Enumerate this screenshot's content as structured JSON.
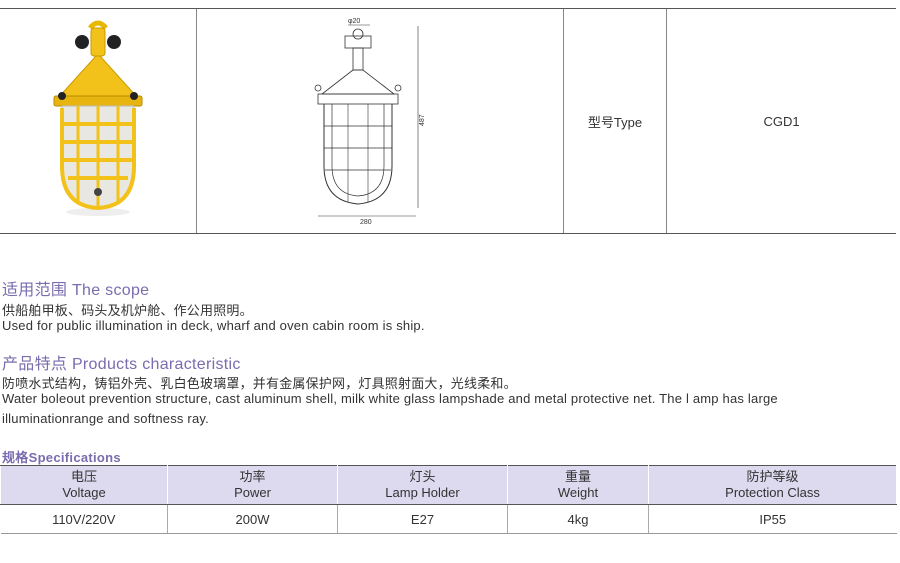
{
  "header_row": {
    "model_label": "型号Type",
    "model_value": "CGD1",
    "drawing": {
      "top_dim": "φ20",
      "height_dim": "487",
      "width_dim": "280"
    }
  },
  "scope": {
    "title": "适用范围 The scope",
    "line_cn": "供船舶甲板、码头及机炉舱、作公用照明。",
    "line_en": "Used for public illumination in deck, wharf and oven cabin room is ship."
  },
  "characteristic": {
    "title": "产品特点 Products characteristic",
    "line_cn": "防喷水式结构，铸铝外壳、乳白色玻璃罩，并有金属保护网，灯具照射面大，光线柔和。",
    "line_en1": "Water boleout prevention structure, cast aluminum shell, milk white glass lampshade and metal protective net. The l  amp has large",
    "line_en2": "illuminationrange and softness ray."
  },
  "specs": {
    "title": "规格Specifications",
    "headers": [
      {
        "cn": "电压",
        "en": "Voltage"
      },
      {
        "cn": "功率",
        "en": "Power"
      },
      {
        "cn": "灯头",
        "en": "Lamp Holder"
      },
      {
        "cn": "重量",
        "en": "Weight"
      },
      {
        "cn": "防护等级",
        "en": "Protection Class"
      }
    ],
    "row": [
      "110V/220V",
      "200W",
      "E27",
      "4kg",
      "IP55"
    ]
  },
  "colors": {
    "accent": "#7a6cae",
    "header_bg": "#ddd9ee",
    "lamp_yellow": "#f2c21a"
  }
}
